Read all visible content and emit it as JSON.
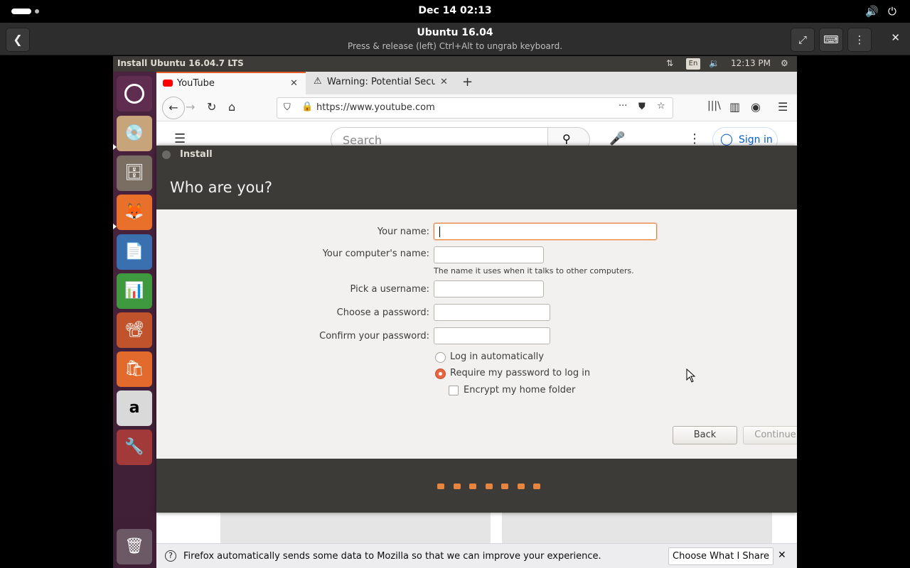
{
  "gnome_bar": {
    "datetime": "Dec 14  02:13"
  },
  "viewer": {
    "title": "Ubuntu 16.04",
    "subtitle": "Press & release (left) Ctrl+Alt to ungrab keyboard."
  },
  "guest_panel": {
    "window_title": "Install Ubuntu 16.04.7 LTS",
    "keyboard_indicator": "En",
    "time": "12:13 PM"
  },
  "launcher": {
    "items": [
      {
        "name": "dash-icon"
      },
      {
        "name": "install-ubuntu-icon"
      },
      {
        "name": "files-icon"
      },
      {
        "name": "firefox-icon"
      },
      {
        "name": "libreoffice-writer-icon"
      },
      {
        "name": "libreoffice-calc-icon"
      },
      {
        "name": "libreoffice-impress-icon"
      },
      {
        "name": "ubuntu-software-icon"
      },
      {
        "name": "amazon-icon"
      },
      {
        "name": "system-settings-icon"
      },
      {
        "name": "trash-icon"
      }
    ]
  },
  "firefox": {
    "tabs": [
      {
        "title": "YouTube",
        "active": true
      },
      {
        "title": "Warning: Potential Secu",
        "active": false
      }
    ],
    "url": "https://www.youtube.com",
    "youtube": {
      "search_placeholder": "Search",
      "sign_in": "Sign in"
    },
    "notice": {
      "text": "Firefox automatically sends some data to Mozilla so that we can improve your experience.",
      "button": "Choose What I Share"
    }
  },
  "installer": {
    "window_title": "Install",
    "heading": "Who are you?",
    "fields": {
      "your_name": {
        "label": "Your name:",
        "value": ""
      },
      "computer_name": {
        "label": "Your computer's name:",
        "value": "",
        "hint": "The name it uses when it talks to other computers."
      },
      "username": {
        "label": "Pick a username:",
        "value": ""
      },
      "password": {
        "label": "Choose a password:",
        "value": ""
      },
      "confirm_password": {
        "label": "Confirm your password:",
        "value": ""
      }
    },
    "options": {
      "log_in_automatically": {
        "label": "Log in automatically",
        "selected": false
      },
      "require_password": {
        "label": "Require my password to log in",
        "selected": true
      },
      "encrypt_home": {
        "label": "Encrypt my home folder",
        "checked": false
      }
    },
    "buttons": {
      "back": "Back",
      "continue": "Continue"
    },
    "progress": {
      "total_steps": 7
    }
  },
  "colors": {
    "accent": "#e7853f",
    "panel": "#3c3b37",
    "launcher": "#4b2340",
    "link": "#065fd4"
  }
}
